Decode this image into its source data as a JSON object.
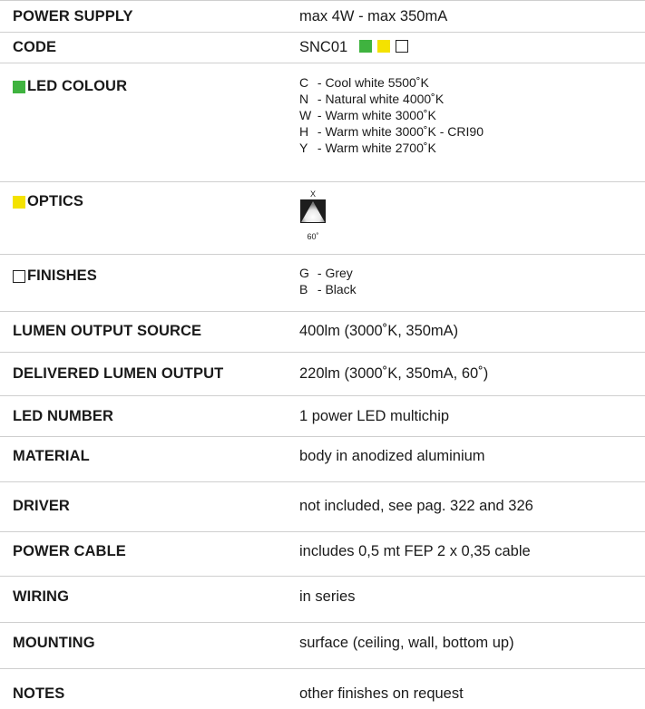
{
  "rows": {
    "power_supply": {
      "label": "POWER SUPPLY",
      "value": "max 4W - max 350mA"
    },
    "code": {
      "label": "CODE",
      "value": "SNC01"
    },
    "led_colour": {
      "label": "LED COLOUR",
      "items": [
        {
          "key": "C",
          "text": " - Cool white 5500˚K"
        },
        {
          "key": "N",
          "text": " - Natural white 4000˚K"
        },
        {
          "key": "W",
          "text": " - Warm white 3000˚K"
        },
        {
          "key": "H",
          "text": " - Warm white 3000˚K - CRI90"
        },
        {
          "key": "Y",
          "text": " - Warm white 2700˚K"
        }
      ]
    },
    "optics": {
      "label": "OPTICS",
      "optic_code": "X",
      "optic_angle": "60˚"
    },
    "finishes": {
      "label": "FINISHES",
      "items": [
        {
          "key": "G",
          "text": " - Grey"
        },
        {
          "key": "B",
          "text": " - Black"
        }
      ]
    },
    "lumen_source": {
      "label": "LUMEN OUTPUT SOURCE",
      "value": "400lm (3000˚K, 350mA)"
    },
    "delivered_lumen": {
      "label": "DELIVERED LUMEN OUTPUT",
      "value": "220lm (3000˚K, 350mA, 60˚)"
    },
    "led_number": {
      "label": "LED NUMBER",
      "value": "1 power LED multichip"
    },
    "material": {
      "label": "MATERIAL",
      "value": "body in anodized aluminium"
    },
    "driver": {
      "label": "DRIVER",
      "value": "not included, see pag. 322 and 326"
    },
    "power_cable": {
      "label": "POWER CABLE",
      "value": "includes 0,5 mt FEP 2 x 0,35 cable"
    },
    "wiring": {
      "label": "WIRING",
      "value": "in series"
    },
    "mounting": {
      "label": "MOUNTING",
      "value": "surface (ceiling, wall, bottom up)"
    },
    "notes": {
      "label": "NOTES",
      "value": "other finishes on request"
    }
  },
  "colors": {
    "green_marker": "#3fb33f",
    "yellow_marker": "#f4e200",
    "white_marker": "#ffffff"
  }
}
